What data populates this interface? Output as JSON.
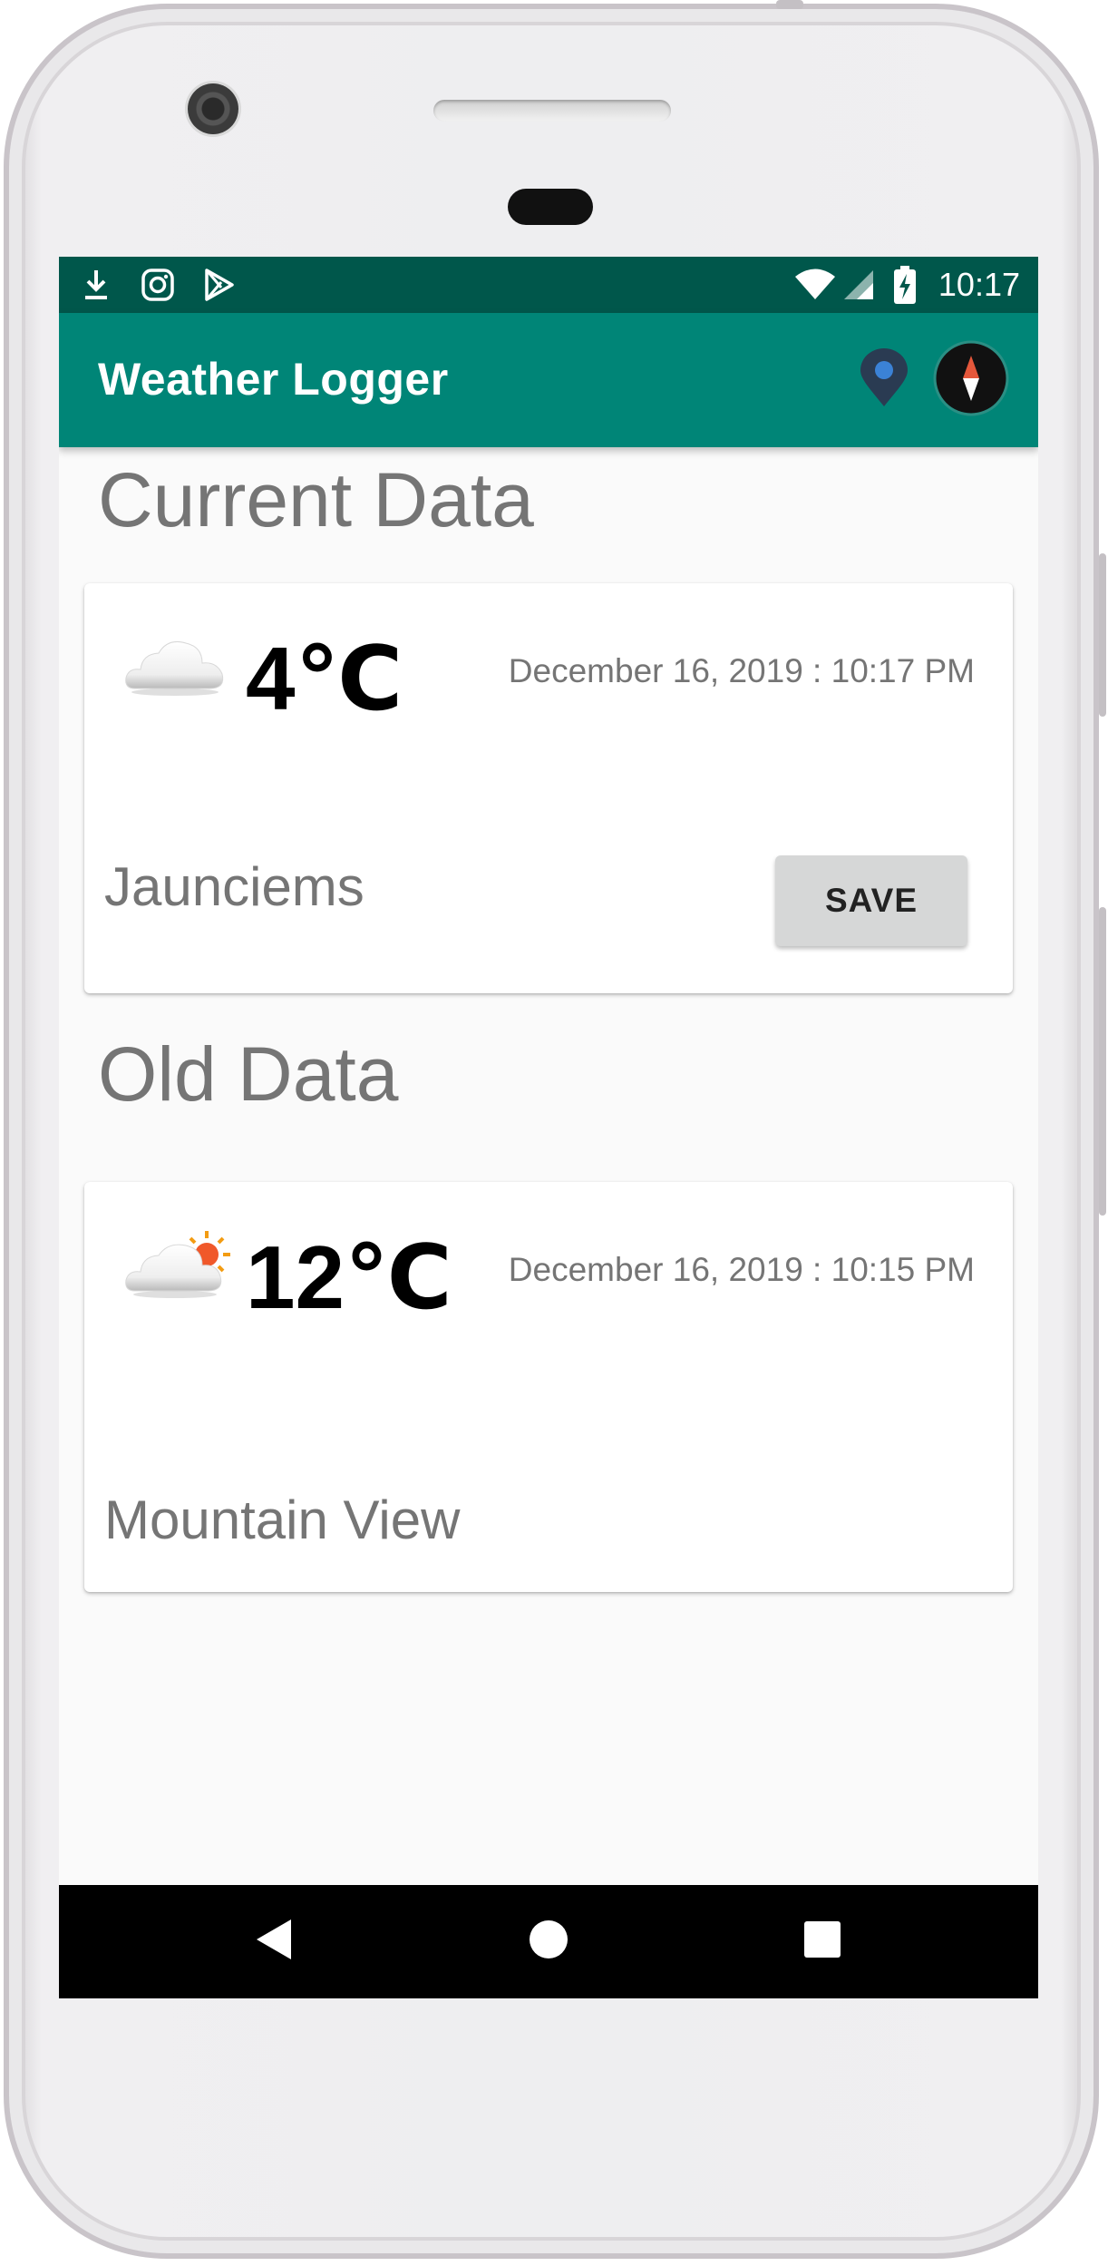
{
  "status_bar": {
    "icons": [
      "download-icon",
      "instagram-icon",
      "play-store-icon",
      "wifi-icon",
      "signal-icon",
      "battery-charging-icon"
    ],
    "time": "10:17"
  },
  "app_bar": {
    "title": "Weather Logger",
    "actions": [
      "location-pin-icon",
      "compass-icon"
    ]
  },
  "current_section": {
    "title": "Current Data",
    "card": {
      "icon": "cloud-icon",
      "temperature": "4℃",
      "datetime": "December 16, 2019 : 10:17 PM",
      "location": "Jaunciems",
      "save_label": "SAVE"
    }
  },
  "old_section": {
    "title": "Old Data",
    "items": [
      {
        "icon": "cloud-sun-icon",
        "temperature": "12℃",
        "datetime": "December 16, 2019 : 10:15 PM",
        "location": "Mountain View"
      }
    ]
  },
  "nav_bar": {
    "buttons": [
      "back-icon",
      "home-icon",
      "recents-icon"
    ]
  },
  "colors": {
    "status_bar": "#00574b",
    "app_bar": "#008577",
    "background": "#fafafa",
    "secondary_text": "#757575"
  }
}
